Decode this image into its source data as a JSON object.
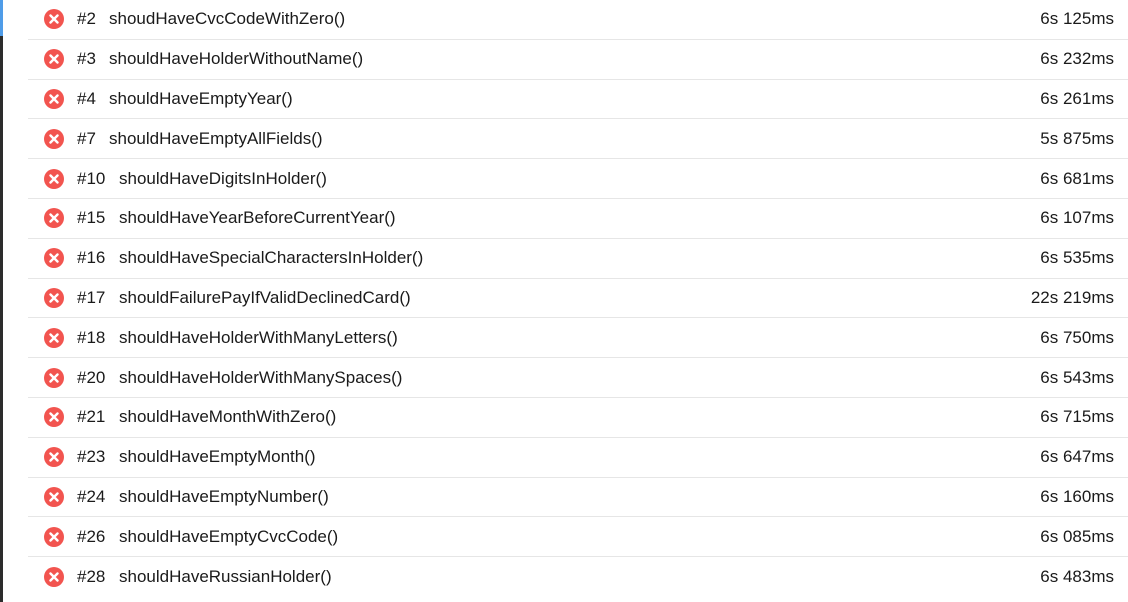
{
  "status_icon": "failed-icon",
  "status_color": "#f2544f",
  "tests": [
    {
      "order": "#2",
      "name": "shoudHaveCvcCodeWithZero()",
      "duration": "6s 125ms"
    },
    {
      "order": "#3",
      "name": "shouldHaveHolderWithoutName()",
      "duration": "6s 232ms"
    },
    {
      "order": "#4",
      "name": "shouldHaveEmptyYear()",
      "duration": "6s 261ms"
    },
    {
      "order": "#7",
      "name": "shouldHaveEmptyAllFields()",
      "duration": "5s 875ms"
    },
    {
      "order": "#10",
      "name": "shouldHaveDigitsInHolder()",
      "duration": "6s 681ms"
    },
    {
      "order": "#15",
      "name": "shouldHaveYearBeforeCurrentYear()",
      "duration": "6s 107ms"
    },
    {
      "order": "#16",
      "name": "shouldHaveSpecialCharactersInHolder()",
      "duration": "6s 535ms"
    },
    {
      "order": "#17",
      "name": "shouldFailurePayIfValidDeclinedCard()",
      "duration": "22s 219ms"
    },
    {
      "order": "#18",
      "name": "shouldHaveHolderWithManyLetters()",
      "duration": "6s 750ms"
    },
    {
      "order": "#20",
      "name": "shouldHaveHolderWithManySpaces()",
      "duration": "6s 543ms"
    },
    {
      "order": "#21",
      "name": "shouldHaveMonthWithZero()",
      "duration": "6s 715ms"
    },
    {
      "order": "#23",
      "name": "shouldHaveEmptyMonth()",
      "duration": "6s 647ms"
    },
    {
      "order": "#24",
      "name": "shouldHaveEmptyNumber()",
      "duration": "6s 160ms"
    },
    {
      "order": "#26",
      "name": "shouldHaveEmptyCvcCode()",
      "duration": "6s 085ms"
    },
    {
      "order": "#28",
      "name": "shouldHaveRussianHolder()",
      "duration": "6s 483ms"
    }
  ]
}
